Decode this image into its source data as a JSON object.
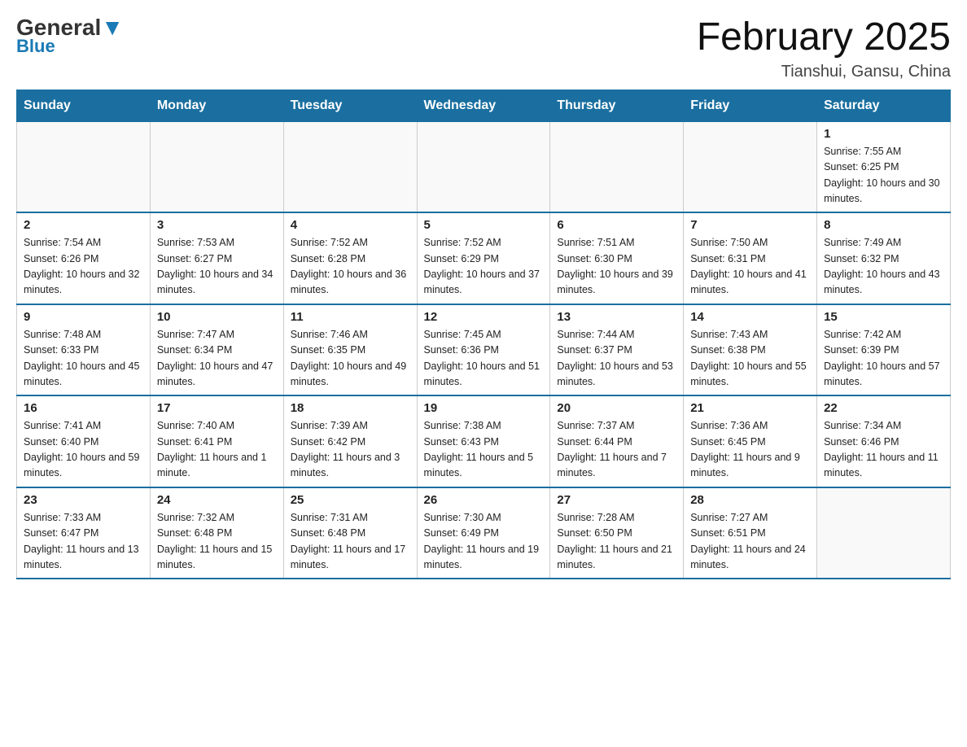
{
  "header": {
    "logo_general": "General",
    "logo_blue": "Blue",
    "month_year": "February 2025",
    "location": "Tianshui, Gansu, China"
  },
  "days_of_week": [
    "Sunday",
    "Monday",
    "Tuesday",
    "Wednesday",
    "Thursday",
    "Friday",
    "Saturday"
  ],
  "weeks": [
    [
      {
        "day": "",
        "info": ""
      },
      {
        "day": "",
        "info": ""
      },
      {
        "day": "",
        "info": ""
      },
      {
        "day": "",
        "info": ""
      },
      {
        "day": "",
        "info": ""
      },
      {
        "day": "",
        "info": ""
      },
      {
        "day": "1",
        "info": "Sunrise: 7:55 AM\nSunset: 6:25 PM\nDaylight: 10 hours and 30 minutes."
      }
    ],
    [
      {
        "day": "2",
        "info": "Sunrise: 7:54 AM\nSunset: 6:26 PM\nDaylight: 10 hours and 32 minutes."
      },
      {
        "day": "3",
        "info": "Sunrise: 7:53 AM\nSunset: 6:27 PM\nDaylight: 10 hours and 34 minutes."
      },
      {
        "day": "4",
        "info": "Sunrise: 7:52 AM\nSunset: 6:28 PM\nDaylight: 10 hours and 36 minutes."
      },
      {
        "day": "5",
        "info": "Sunrise: 7:52 AM\nSunset: 6:29 PM\nDaylight: 10 hours and 37 minutes."
      },
      {
        "day": "6",
        "info": "Sunrise: 7:51 AM\nSunset: 6:30 PM\nDaylight: 10 hours and 39 minutes."
      },
      {
        "day": "7",
        "info": "Sunrise: 7:50 AM\nSunset: 6:31 PM\nDaylight: 10 hours and 41 minutes."
      },
      {
        "day": "8",
        "info": "Sunrise: 7:49 AM\nSunset: 6:32 PM\nDaylight: 10 hours and 43 minutes."
      }
    ],
    [
      {
        "day": "9",
        "info": "Sunrise: 7:48 AM\nSunset: 6:33 PM\nDaylight: 10 hours and 45 minutes."
      },
      {
        "day": "10",
        "info": "Sunrise: 7:47 AM\nSunset: 6:34 PM\nDaylight: 10 hours and 47 minutes."
      },
      {
        "day": "11",
        "info": "Sunrise: 7:46 AM\nSunset: 6:35 PM\nDaylight: 10 hours and 49 minutes."
      },
      {
        "day": "12",
        "info": "Sunrise: 7:45 AM\nSunset: 6:36 PM\nDaylight: 10 hours and 51 minutes."
      },
      {
        "day": "13",
        "info": "Sunrise: 7:44 AM\nSunset: 6:37 PM\nDaylight: 10 hours and 53 minutes."
      },
      {
        "day": "14",
        "info": "Sunrise: 7:43 AM\nSunset: 6:38 PM\nDaylight: 10 hours and 55 minutes."
      },
      {
        "day": "15",
        "info": "Sunrise: 7:42 AM\nSunset: 6:39 PM\nDaylight: 10 hours and 57 minutes."
      }
    ],
    [
      {
        "day": "16",
        "info": "Sunrise: 7:41 AM\nSunset: 6:40 PM\nDaylight: 10 hours and 59 minutes."
      },
      {
        "day": "17",
        "info": "Sunrise: 7:40 AM\nSunset: 6:41 PM\nDaylight: 11 hours and 1 minute."
      },
      {
        "day": "18",
        "info": "Sunrise: 7:39 AM\nSunset: 6:42 PM\nDaylight: 11 hours and 3 minutes."
      },
      {
        "day": "19",
        "info": "Sunrise: 7:38 AM\nSunset: 6:43 PM\nDaylight: 11 hours and 5 minutes."
      },
      {
        "day": "20",
        "info": "Sunrise: 7:37 AM\nSunset: 6:44 PM\nDaylight: 11 hours and 7 minutes."
      },
      {
        "day": "21",
        "info": "Sunrise: 7:36 AM\nSunset: 6:45 PM\nDaylight: 11 hours and 9 minutes."
      },
      {
        "day": "22",
        "info": "Sunrise: 7:34 AM\nSunset: 6:46 PM\nDaylight: 11 hours and 11 minutes."
      }
    ],
    [
      {
        "day": "23",
        "info": "Sunrise: 7:33 AM\nSunset: 6:47 PM\nDaylight: 11 hours and 13 minutes."
      },
      {
        "day": "24",
        "info": "Sunrise: 7:32 AM\nSunset: 6:48 PM\nDaylight: 11 hours and 15 minutes."
      },
      {
        "day": "25",
        "info": "Sunrise: 7:31 AM\nSunset: 6:48 PM\nDaylight: 11 hours and 17 minutes."
      },
      {
        "day": "26",
        "info": "Sunrise: 7:30 AM\nSunset: 6:49 PM\nDaylight: 11 hours and 19 minutes."
      },
      {
        "day": "27",
        "info": "Sunrise: 7:28 AM\nSunset: 6:50 PM\nDaylight: 11 hours and 21 minutes."
      },
      {
        "day": "28",
        "info": "Sunrise: 7:27 AM\nSunset: 6:51 PM\nDaylight: 11 hours and 24 minutes."
      },
      {
        "day": "",
        "info": ""
      }
    ]
  ]
}
